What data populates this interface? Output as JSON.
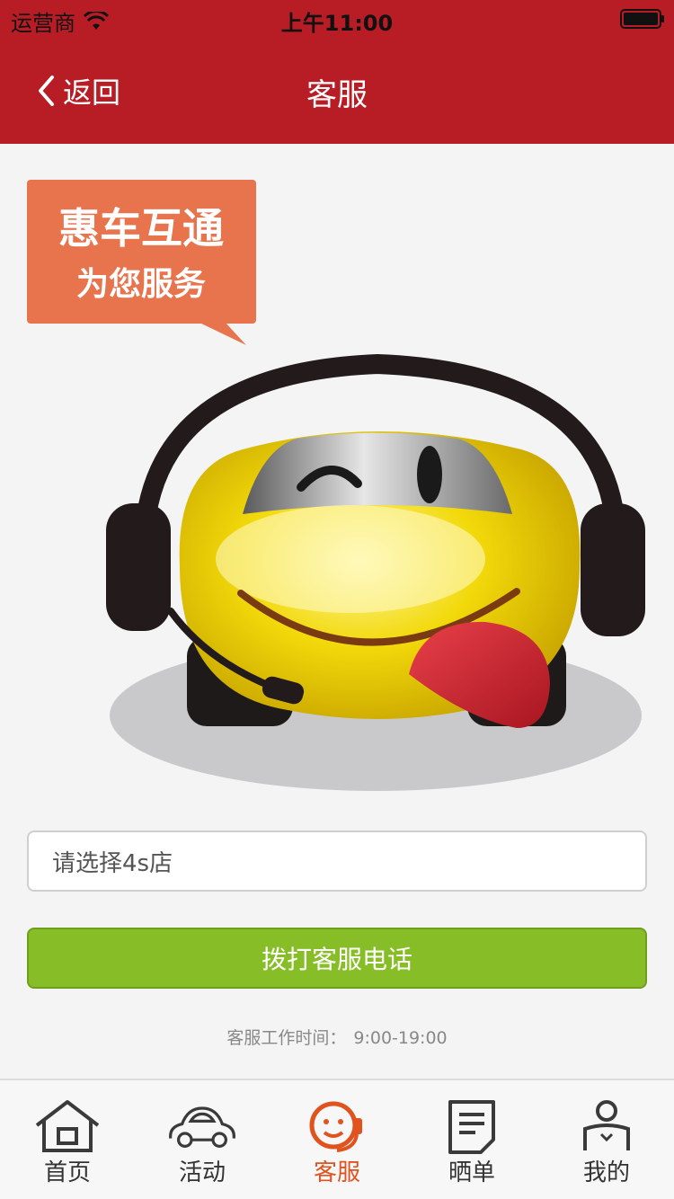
{
  "status_bar": {
    "carrier": "运营商",
    "time": "上午11:00"
  },
  "header": {
    "back_label": "返回",
    "title": "客服"
  },
  "banner": {
    "line1": "惠车互通",
    "line2": "为您服务"
  },
  "form": {
    "store_select_placeholder": "请选择4s店",
    "call_button_label": "拨打客服电话",
    "hours_label": "客服工作时间：",
    "hours_value": "9:00-19:00"
  },
  "tabs": [
    {
      "label": "首页",
      "icon": "home-icon"
    },
    {
      "label": "活动",
      "icon": "car-icon"
    },
    {
      "label": "客服",
      "icon": "customer-service-icon",
      "active": true
    },
    {
      "label": "晒单",
      "icon": "document-icon"
    },
    {
      "label": "我的",
      "icon": "profile-icon"
    }
  ],
  "colors": {
    "header_bg": "#b81c25",
    "accent": "#e0531f",
    "button_green": "#87be27",
    "banner_orange": "#e8744e"
  }
}
